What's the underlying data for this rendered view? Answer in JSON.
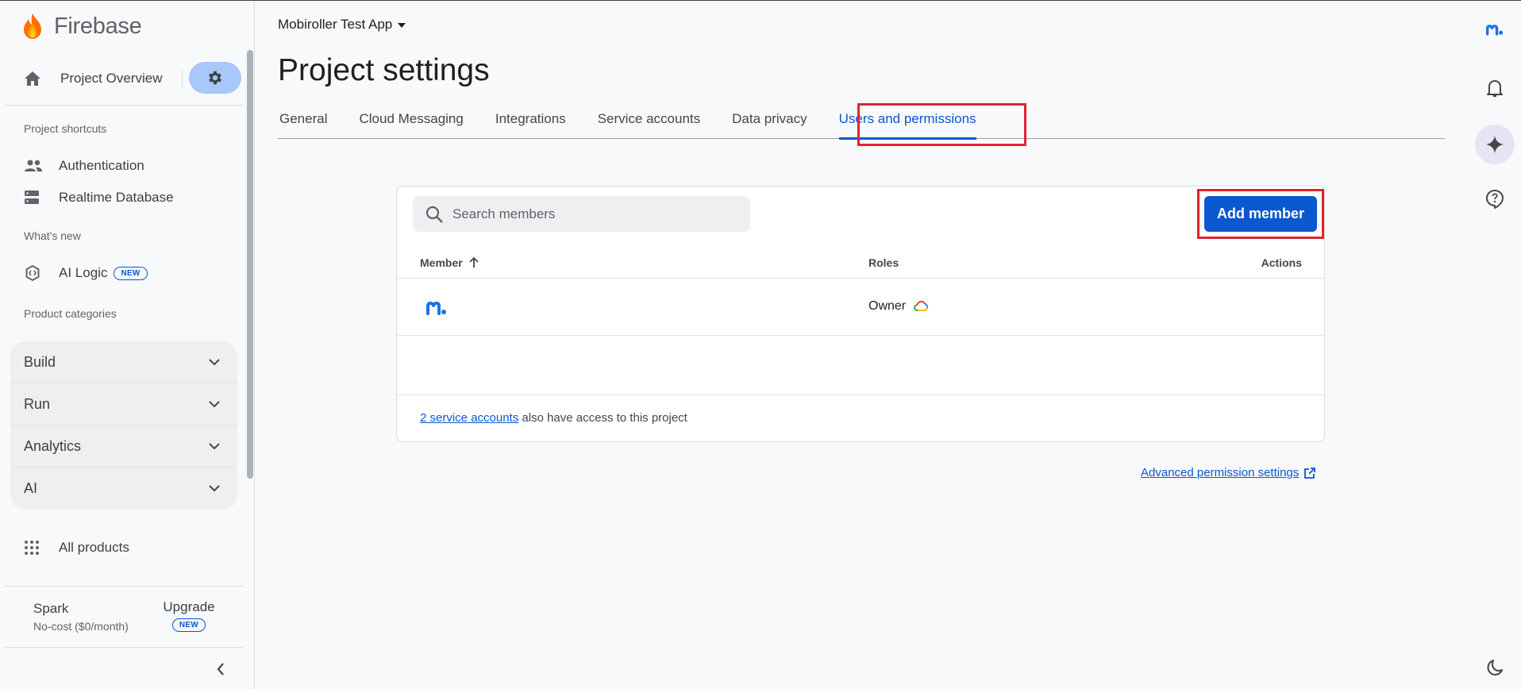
{
  "sidebar": {
    "brand": "Firebase",
    "overview_label": "Project Overview",
    "shortcuts_label": "Project shortcuts",
    "shortcuts": [
      {
        "label": "Authentication",
        "icon": "people-icon"
      },
      {
        "label": "Realtime Database",
        "icon": "database-icon"
      }
    ],
    "whats_new_label": "What's new",
    "ai_logic_label": "AI Logic",
    "new_badge": "NEW",
    "categories_label": "Product categories",
    "categories": [
      "Build",
      "Run",
      "Analytics",
      "AI"
    ],
    "all_products_label": "All products",
    "plan": {
      "name": "Spark",
      "cost": "No-cost ($0/month)",
      "upgrade_label": "Upgrade",
      "upgrade_badge": "NEW"
    }
  },
  "header": {
    "project_name": "Mobiroller Test App",
    "page_title": "Project settings"
  },
  "tabs": [
    {
      "label": "General",
      "active": false
    },
    {
      "label": "Cloud Messaging",
      "active": false
    },
    {
      "label": "Integrations",
      "active": false
    },
    {
      "label": "Service accounts",
      "active": false
    },
    {
      "label": "Data privacy",
      "active": false
    },
    {
      "label": "Users and permissions",
      "active": true
    }
  ],
  "members": {
    "search_placeholder": "Search members",
    "add_member_label": "Add member",
    "columns": {
      "member": "Member",
      "roles": "Roles",
      "actions": "Actions"
    },
    "rows": [
      {
        "avatar": "mobiroller-logo",
        "role": "Owner",
        "role_icon": "google-cloud-icon"
      }
    ],
    "footer_link": "2 service accounts",
    "footer_text": " also have access to this project"
  },
  "advanced_link": "Advanced permission settings",
  "colors": {
    "primary": "#0b57d0",
    "highlight": "#e0242e",
    "settings_pill": "#a8c7fa"
  }
}
